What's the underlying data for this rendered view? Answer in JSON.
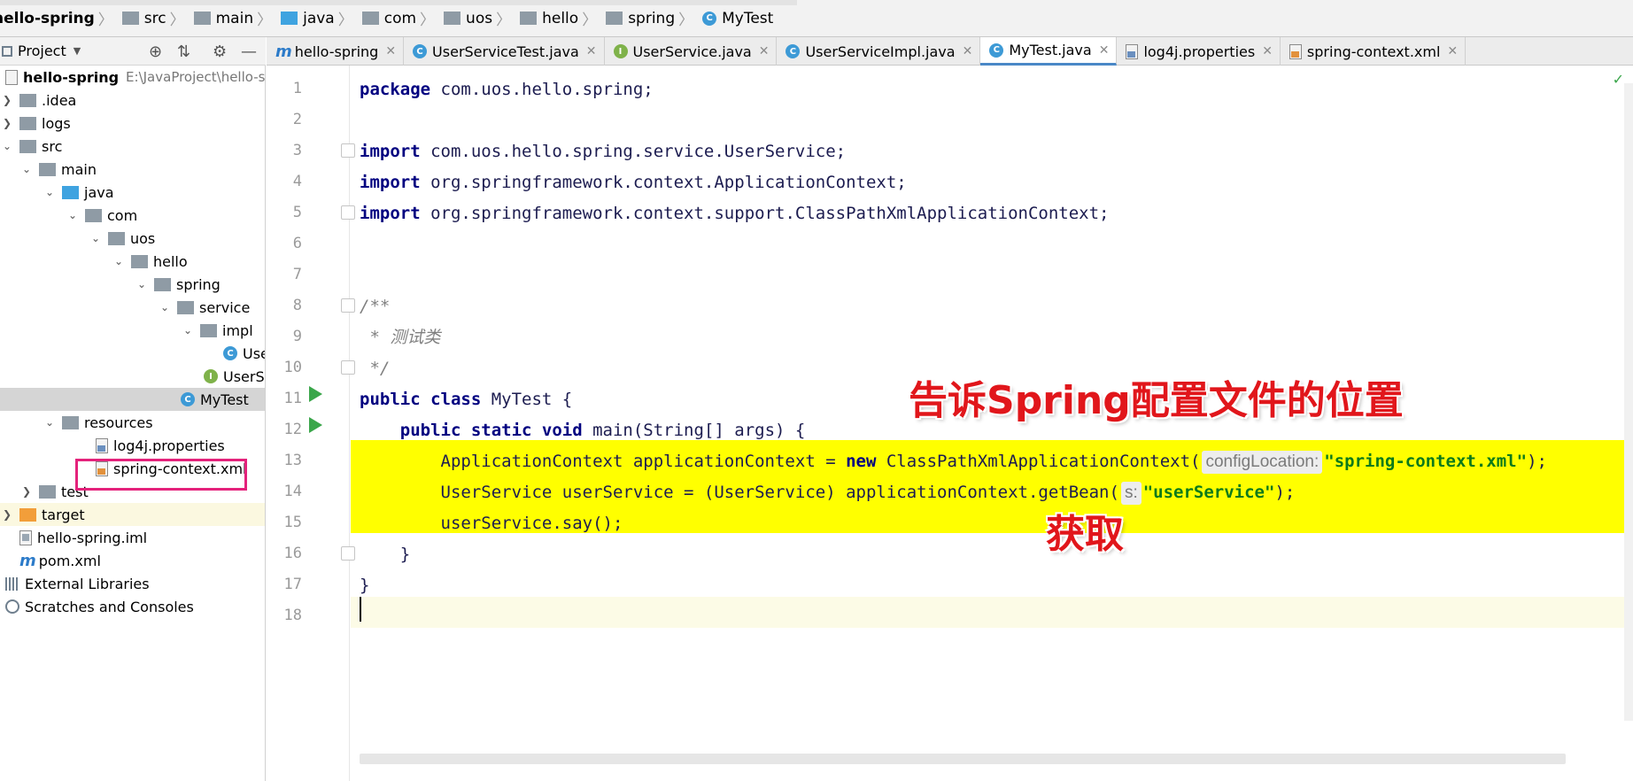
{
  "breadcrumb": [
    "hello-spring",
    "src",
    "main",
    "java",
    "com",
    "uos",
    "hello",
    "spring",
    "MyTest"
  ],
  "project_panel": {
    "title": "Project",
    "tree": [
      {
        "label": "hello-spring",
        "path": "E:\\JavaProject\\hello-spri"
      },
      {
        "label": ".idea"
      },
      {
        "label": "logs"
      },
      {
        "label": "src"
      },
      {
        "label": "main"
      },
      {
        "label": "java"
      },
      {
        "label": "com"
      },
      {
        "label": "uos"
      },
      {
        "label": "hello"
      },
      {
        "label": "spring"
      },
      {
        "label": "service"
      },
      {
        "label": "impl"
      },
      {
        "label": "Use"
      },
      {
        "label": "UserSe"
      },
      {
        "label": "MyTest"
      },
      {
        "label": "resources"
      },
      {
        "label": "log4j.properties"
      },
      {
        "label": "spring-context.xml"
      },
      {
        "label": "test"
      },
      {
        "label": "target"
      },
      {
        "label": "hello-spring.iml"
      },
      {
        "label": "pom.xml"
      },
      {
        "label": "External Libraries"
      },
      {
        "label": "Scratches and Consoles"
      }
    ]
  },
  "tabs": [
    {
      "label": "hello-spring",
      "icon": "maven-icon"
    },
    {
      "label": "UserServiceTest.java",
      "icon": "class-icon"
    },
    {
      "label": "UserService.java",
      "icon": "interface-icon"
    },
    {
      "label": "UserServiceImpl.java",
      "icon": "class-icon"
    },
    {
      "label": "MyTest.java",
      "icon": "class-icon",
      "active": true
    },
    {
      "label": "log4j.properties",
      "icon": "properties-icon"
    },
    {
      "label": "spring-context.xml",
      "icon": "xml-icon"
    }
  ],
  "editor": {
    "line_numbers": [
      "1",
      "2",
      "3",
      "4",
      "5",
      "6",
      "7",
      "8",
      "9",
      "10",
      "11",
      "12",
      "13",
      "14",
      "15",
      "16",
      "17",
      "18"
    ],
    "code": {
      "l1_kw": "package",
      "l1_rest": " com.uos.hello.spring;",
      "l3_kw": "import",
      "l3_rest": " com.uos.hello.spring.service.UserService;",
      "l4_kw": "import",
      "l4_rest": " org.springframework.context.ApplicationContext;",
      "l5_kw": "import",
      "l5_rest": " org.springframework.context.support.ClassPathXmlApplicationContext;",
      "l8": "/**",
      "l9": " * 测试类",
      "l10": " */",
      "l11_kw": "public class",
      "l11_rest": " MyTest {",
      "l12_indent": "    ",
      "l12_kw": "public static void",
      "l12_rest": " main(String[] args) {",
      "l13_a": "        ApplicationContext applicationContext = ",
      "l13_new": "new",
      "l13_b": " ClassPathXmlApplicationContext(",
      "l13_hint": "configLocation:",
      "l13_str": "\"spring-context.xml\"",
      "l13_end": ");",
      "l14_a": "        UserService userService = (UserService) applicationContext.getBean(",
      "l14_hint": "s:",
      "l14_str": "\"userService\"",
      "l14_end": ");",
      "l15": "        userService.say();",
      "l16": "    }",
      "l17": "}"
    }
  },
  "annotations": {
    "config_location": "告诉Spring配置文件的位置",
    "get": "获取"
  },
  "colors": {
    "highlight_yellow": "#ffff00",
    "annotation_red": "#e1161b",
    "box_pink": "#e4227b"
  }
}
